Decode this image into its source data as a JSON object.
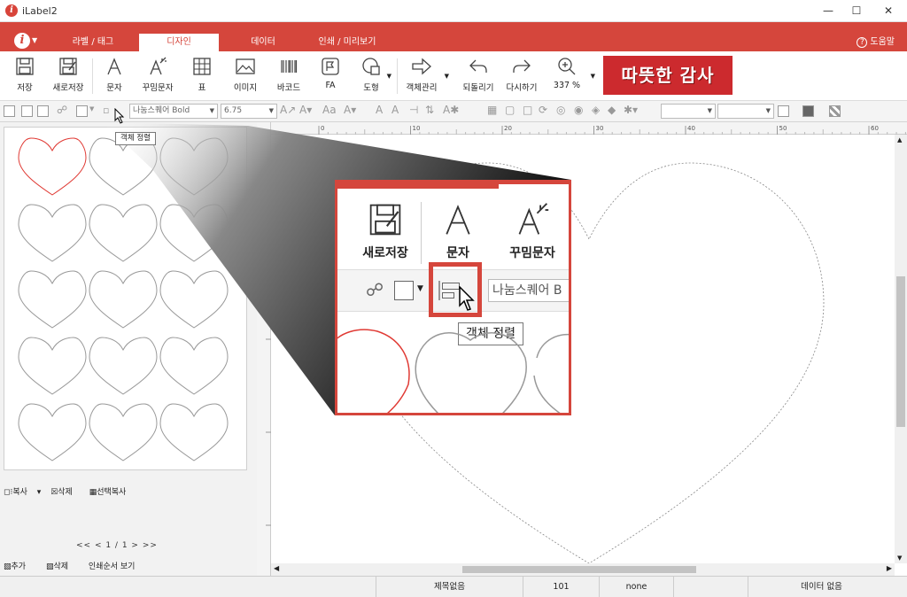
{
  "window": {
    "title": "iLabel2"
  },
  "ribbon": {
    "tabs": [
      {
        "label": "라벨 / 태그"
      },
      {
        "label": "디자인"
      },
      {
        "label": "데이터"
      },
      {
        "label": "인쇄 / 미리보기"
      }
    ],
    "help": "도움말"
  },
  "toolbar": {
    "buttons": [
      {
        "label": "저장",
        "icon": "save-icon"
      },
      {
        "label": "새로저장",
        "icon": "save-as-icon"
      },
      {
        "label": "문자",
        "icon": "text-icon"
      },
      {
        "label": "꾸밈문자",
        "icon": "fancy-text-icon"
      },
      {
        "label": "표",
        "icon": "table-icon"
      },
      {
        "label": "이미지",
        "icon": "image-icon"
      },
      {
        "label": "바코드",
        "icon": "barcode-icon"
      },
      {
        "label": "FA",
        "icon": "fa-icon"
      },
      {
        "label": "도형",
        "icon": "shape-icon"
      },
      {
        "label": "객체관리",
        "icon": "object-manage-icon"
      },
      {
        "label": "되돌리기",
        "icon": "undo-icon"
      },
      {
        "label": "다시하기",
        "icon": "redo-icon"
      },
      {
        "label": "337 %",
        "icon": "zoom-icon"
      }
    ],
    "banner": "따뜻한 감사"
  },
  "formatbar": {
    "font": "나눔스퀘어 Bold",
    "size": "6.75"
  },
  "tooltip": "객체 정렬",
  "ruler": {
    "ticks": [
      "0",
      "10",
      "20",
      "30",
      "40",
      "50",
      "60"
    ]
  },
  "leftpanel": {
    "copy": "복사",
    "delete": "삭제",
    "select_copy": "선택복사",
    "pager": "<< < 1 / 1 > >>",
    "add": "추가",
    "delete2": "삭제",
    "print_order": "인쇄순서 보기"
  },
  "zoom": {
    "save_as": "새로저장",
    "text": "문자",
    "fancy": "꾸밈문자",
    "font": "나눔스퀘어 B",
    "tooltip": "객체 정렬"
  },
  "status": {
    "title": "제목없음",
    "number": "101",
    "none": "none",
    "data": "데이터 없음"
  },
  "colors": {
    "accent": "#d5463c"
  }
}
